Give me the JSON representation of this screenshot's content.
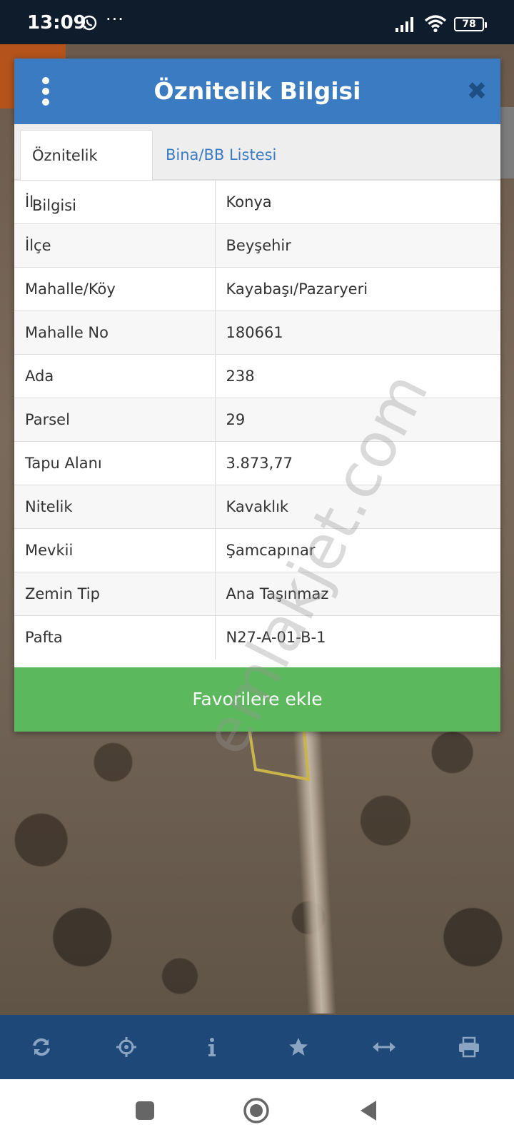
{
  "status_bar": {
    "time": "13:09",
    "more": "···",
    "battery": "78"
  },
  "dialog": {
    "title": "Öznitelik Bilgisi",
    "tabs": [
      {
        "label": "Öznitelik Bilgisi",
        "active": true
      },
      {
        "label": "Bina/BB Listesi",
        "active": false
      }
    ],
    "rows": [
      {
        "key": "İl",
        "value": "Konya"
      },
      {
        "key": "İlçe",
        "value": "Beyşehir"
      },
      {
        "key": "Mahalle/Köy",
        "value": "Kayabaşı/Pazaryeri"
      },
      {
        "key": "Mahalle No",
        "value": "180661"
      },
      {
        "key": "Ada",
        "value": "238"
      },
      {
        "key": "Parsel",
        "value": "29"
      },
      {
        "key": "Tapu Alanı",
        "value": "3.873,77"
      },
      {
        "key": "Nitelik",
        "value": "Kavaklık"
      },
      {
        "key": "Mevkii",
        "value": "Şamcapınar"
      },
      {
        "key": "Zemin Tip",
        "value": "Ana Taşınmaz"
      },
      {
        "key": "Pafta",
        "value": "N27-A-01-B-1"
      }
    ],
    "favorite_button": "Favorilere ekle",
    "close_symbol": "✖"
  },
  "watermark": "emlakjet.com",
  "toolbar": {
    "icons": [
      "refresh-icon",
      "locate-icon",
      "info-icon",
      "star-icon",
      "measure-icon",
      "print-icon"
    ]
  },
  "colors": {
    "header": "#3a7bc1",
    "favorite": "#5cb85c",
    "toolbar": "#1d4877",
    "status_bar": "#0f1c2b"
  }
}
